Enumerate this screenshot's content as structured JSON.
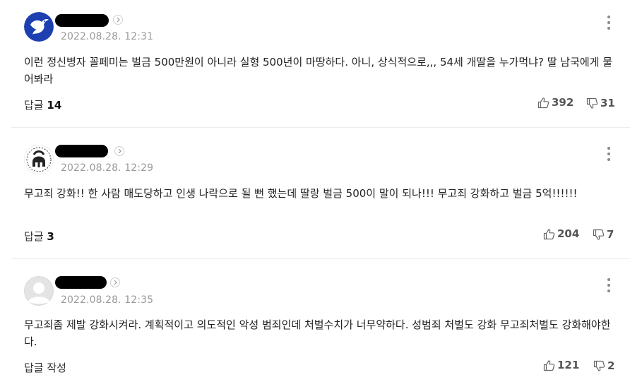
{
  "comments": [
    {
      "date": "2022.08.28. 12:31",
      "text": "이런 정신병자 꼴페미는 벌금 500만원이 아니라 실형 500년이 마땅하다. 아니, 상식적으로,,, 54세 개딸을 누가먹냐? 딸 남국에게 물어봐라",
      "reply_label": "답글",
      "reply_count": "14",
      "likes": "392",
      "dislikes": "31",
      "avatar_icon": "bird-logo-icon"
    },
    {
      "date": "2022.08.28. 12:29",
      "text": "무고죄 강화!! 한 사람 매도당하고 인생 나락으로 될 뻔 했는데 딸랑 벌금 500이 말이 되나!!! 무고죄 강화하고 벌금 5억!!!!!!",
      "reply_label": "답글",
      "reply_count": "3",
      "likes": "204",
      "dislikes": "7",
      "avatar_icon": "spartan-helmet-icon"
    },
    {
      "date": "2022.08.28. 12:35",
      "text": "무고죄좀 제발 강화시켜라. 계획적이고 의도적인 악성 범죄인데 처벌수치가 너무약하다. 성범죄 처벌도 강화 무고죄처벌도 강화해야한다.",
      "reply_label": "답글 작성",
      "reply_count": "",
      "likes": "121",
      "dislikes": "2",
      "avatar_icon": "default-user-icon"
    }
  ]
}
